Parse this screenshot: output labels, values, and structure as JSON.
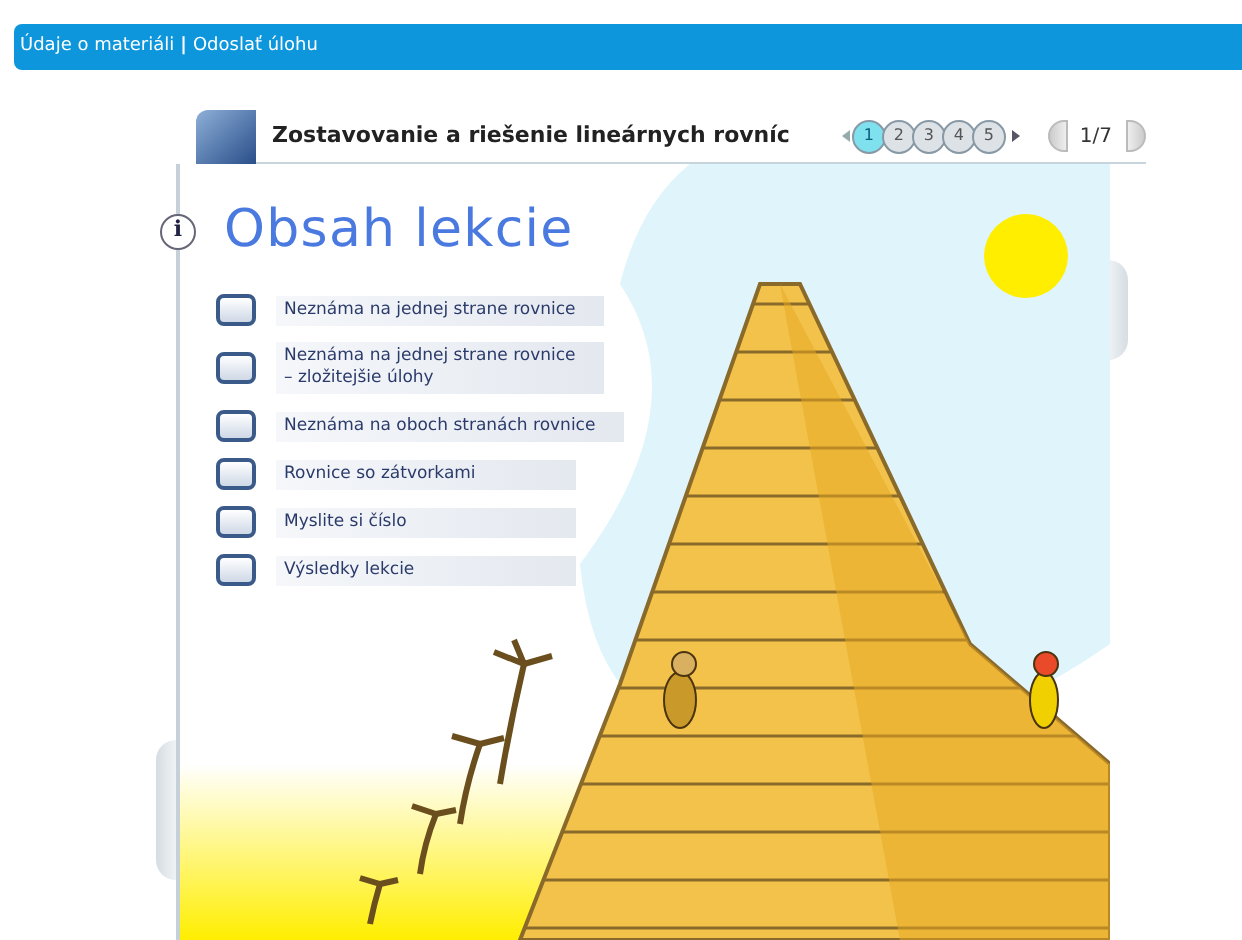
{
  "top_bar": {
    "links": [
      "Údaje o materiáli",
      "Odoslať úlohu"
    ],
    "separator": "|"
  },
  "lesson": {
    "title": "Zostavovanie a riešenie lineárnych rovníc",
    "pages": [
      {
        "label": "1",
        "selected": true
      },
      {
        "label": "2",
        "selected": false
      },
      {
        "label": "3",
        "selected": false
      },
      {
        "label": "4",
        "selected": false
      },
      {
        "label": "5",
        "selected": false
      }
    ],
    "counter": "1/7"
  },
  "content": {
    "heading": "Obsah lekcie",
    "info_badge": "i",
    "items": [
      "Neznáma na jednej strane rovnice",
      "Neznáma na jednej strane rovnice\n– zložitejšie úlohy",
      "Neznáma na oboch stranách rovnice",
      "Rovnice so zátvorkami",
      "Myslite si číslo",
      "Výsledky lekcie"
    ]
  }
}
